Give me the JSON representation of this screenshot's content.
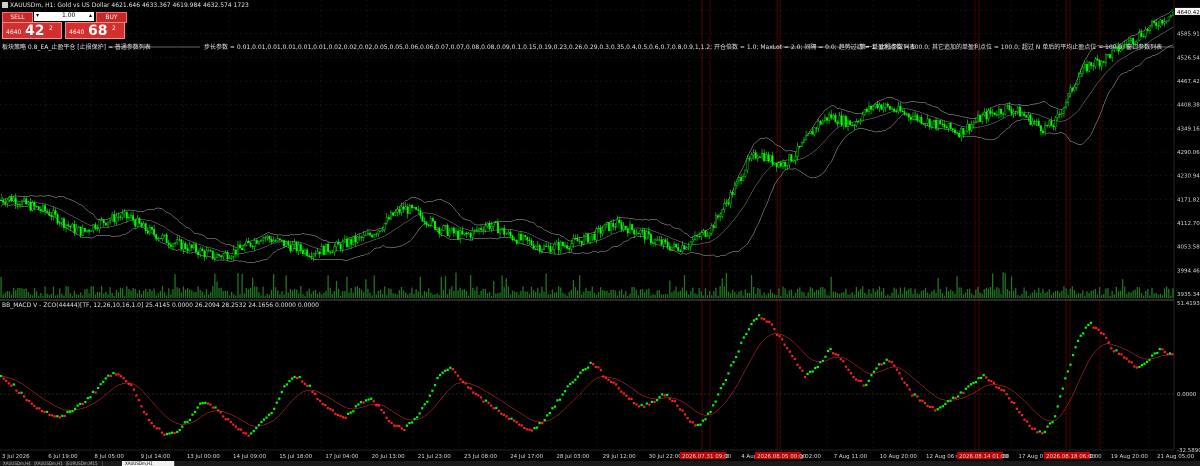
{
  "header": {
    "symbol_info": "XAUUSDm, H1:  Gold vs US Dollar  4621.646 4633.367 4619.984 4632.574  1723",
    "indicator_note_left": "板块策略 0.8_EA_止盈平仓 [止损保护] = 普通参数列表",
    "indicator_note_mid": "步长参数 = 0.01,0.01,0.01,0.01,0.01,0.01,0.02,0.02,0.02,0.05,0.05,0.06,0.06,0.07,0.07,0.08,0.08,0.09,0.1,0.15,0.19,0.23,0.26,0.29,0.3,0.35,0.4,0.5,0.6,0.7,0.8,0.9,1,1.2;  开仓倍数 = 1.0;  MaxLot = 2.0;  间隔 = 0.0;  趋势过滤 = 1;  止损参数列表",
    "indicator_note_right": "第一单盈利点位 = 100.0;  其它追加的单盈利点位 = 100.0;  超过 N 单后的平均止盈点位 = 100.0;  窗口参数列表"
  },
  "trade_panel": {
    "sell_label": "SELL",
    "buy_label": "BUY",
    "lot_value": "1.00",
    "sell_small": "4640",
    "sell_big": "42",
    "sell_sup": "2",
    "buy_small": "4640",
    "buy_big": "68",
    "buy_sup": "2"
  },
  "macd_label": "BB_MACD V - ZCO(44444)[TF, 12,26,10,16,1.0] 25.4145 0.0000 26.2094 28.2532 24.1656 0.0000 0.0000",
  "price_axis": {
    "labels": [
      "4645.20",
      "4585.91",
      "4526.54",
      "4467.42",
      "4408.38",
      "4349.16",
      "4290.06",
      "4230.94",
      "4171.82",
      "4112.70",
      "4053.58",
      "3994.46",
      "3935.34"
    ],
    "current_price": "4640.42"
  },
  "macd_axis": {
    "labels": [
      "51.4193",
      "0.0000",
      "-32.5890"
    ]
  },
  "time_axis": {
    "labels": [
      "3 Jul 2026",
      "6 Jul 19:00",
      "8 Jul 05:00",
      "9 Jul 14:00",
      "13 Jul 00:00",
      "14 Jul 09:00",
      "15 Jul 18:00",
      "17 Jul 04:00",
      "20 Jul 13:00",
      "21 Jul 23:00",
      "23 Jul 08:00",
      "24 Jul 17:00",
      "28 Jul 03:00",
      "29 Jul 12:00",
      "30 Jul 22:00",
      "3 Aug 07:00",
      "4 Aug 16:00",
      "6 Aug 02:00",
      "7 Aug 11:00",
      "10 Aug 20:00",
      "12 Aug 06:00",
      "13 Aug 15:00",
      "17 Aug 01:00",
      "18 Aug 10:00",
      "19 Aug 20:00",
      "21 Aug 05:00"
    ],
    "highlighted": [
      "2026.07.31 09:00",
      "2026.08.05 00:00",
      "2026.08.14 01:00",
      "2026.08.18 06:00"
    ]
  },
  "tabs": [
    "XAUUSDm,H4",
    "XAUUSDm,H1",
    "EURUSDm,M15",
    "XAUUSDm,H1"
  ],
  "colors": {
    "background": "#000000",
    "candle": "#00ff00",
    "grid": "#2a2a2a",
    "band": "#bbbbbb",
    "volume": "#1f7a1f",
    "macd_up": "#00ff00",
    "macd_down": "#ff2020",
    "signal": "#ff3030",
    "vline": "#8b0000",
    "highlight": "#c00000"
  },
  "chart_data": {
    "type": "candlestick",
    "symbol": "XAUUSDm",
    "timeframe": "H1",
    "ylim": [
      3935.34,
      4645.2
    ],
    "close_path": [
      4170,
      4175,
      4160,
      4150,
      4140,
      4120,
      4100,
      4090,
      4110,
      4120,
      4130,
      4125,
      4100,
      4085,
      4070,
      4060,
      4050,
      4040,
      4030,
      4035,
      4045,
      4060,
      4080,
      4070,
      4060,
      4050,
      4040,
      4045,
      4050,
      4060,
      4070,
      4080,
      4100,
      4130,
      4150,
      4140,
      4120,
      4100,
      4090,
      4080,
      4090,
      4110,
      4100,
      4080,
      4070,
      4060,
      4050,
      4055,
      4060,
      4070,
      4080,
      4100,
      4110,
      4100,
      4090,
      4070,
      4060,
      4050,
      4060,
      4080,
      4100,
      4150,
      4200,
      4260,
      4290,
      4270,
      4260,
      4280,
      4320,
      4360,
      4380,
      4370,
      4360,
      4390,
      4410,
      4400,
      4390,
      4380,
      4370,
      4360,
      4350,
      4340,
      4360,
      4380,
      4390,
      4400,
      4390,
      4370,
      4350,
      4360,
      4420,
      4480,
      4510,
      4520,
      4540,
      4560,
      4580,
      4600,
      4620,
      4635
    ],
    "macd_path": [
      10,
      5,
      -2,
      -8,
      -12,
      -15,
      -10,
      -5,
      2,
      10,
      12,
      5,
      -10,
      -20,
      -25,
      -22,
      -15,
      -5,
      -8,
      -15,
      -22,
      -25,
      -18,
      -10,
      5,
      10,
      5,
      -5,
      -10,
      -15,
      -8,
      -2,
      -8,
      -18,
      -22,
      -15,
      -5,
      10,
      15,
      8,
      0,
      -5,
      -10,
      -15,
      -20,
      -22,
      -15,
      -5,
      5,
      12,
      18,
      10,
      5,
      -2,
      -8,
      -5,
      0,
      -5,
      -15,
      -20,
      -10,
      5,
      20,
      35,
      45,
      40,
      30,
      20,
      10,
      15,
      25,
      20,
      10,
      5,
      15,
      20,
      10,
      0,
      -5,
      -10,
      -5,
      0,
      5,
      10,
      5,
      0,
      -10,
      -20,
      -25,
      -15,
      10,
      30,
      40,
      35,
      25,
      20,
      15,
      20,
      25,
      22
    ]
  }
}
